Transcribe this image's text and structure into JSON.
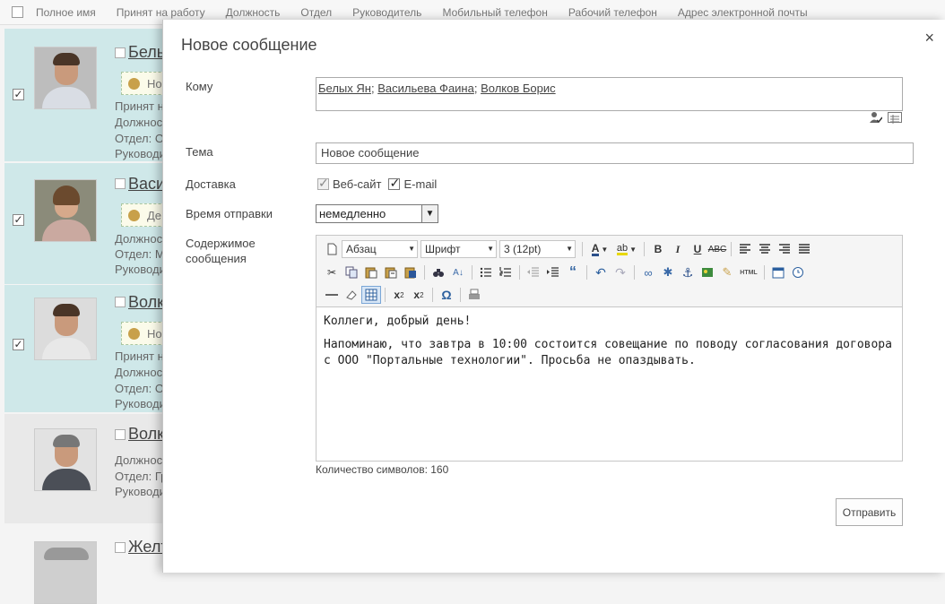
{
  "list": {
    "columns": [
      "Полное имя",
      "Принят на работу",
      "Должность",
      "Отдел",
      "Руководитель",
      "Мобильный телефон",
      "Рабочий телефон",
      "Адрес электронной почты"
    ],
    "rows": [
      {
        "name": "Бель",
        "lines": [
          "Принят н",
          "Должнос",
          "Отдел: О",
          "Руководи"
        ],
        "status": "Но",
        "selected": true
      },
      {
        "name": "Васи",
        "lines": [
          "Должнос",
          "Отдел: М",
          "Руководи"
        ],
        "status": "Де",
        "selected": true
      },
      {
        "name": "Волк",
        "lines": [
          "Принят н",
          "Должнос",
          "Отдел: О",
          "Руководи"
        ],
        "status": "Но",
        "selected": true
      },
      {
        "name": "Волк",
        "lines": [
          "Должнос",
          "Отдел: Гр",
          "Руководи"
        ],
        "selected": false
      },
      {
        "name": "Желт",
        "selected": false
      }
    ]
  },
  "modal": {
    "title": "Новое сообщение",
    "close_label": "×",
    "to_label": "Кому",
    "recipients": [
      "Белых Ян",
      "Васильева Фаина",
      "Волков Борис"
    ],
    "recipient_sep": ";",
    "subject_label": "Тема",
    "subject_value": "Новое сообщение",
    "delivery_label": "Доставка",
    "delivery_web": "Веб-сайт",
    "delivery_email": "E-mail",
    "send_time_label": "Время отправки",
    "send_time_value": "немедленно",
    "content_label_1": "Содержимое",
    "content_label_2": "сообщения",
    "toolbar": {
      "paragraph": "Абзац",
      "font": "Шрифт",
      "size": "3 (12pt)"
    },
    "body_line_1": "Коллеги, добрый день!",
    "body_line_2": "Напоминаю, что завтра в 10:00 состоится совещание по поводу согласования договора с ООО \"Портальные технологии\". Просьба не опаздывать.",
    "char_count": "Количество символов: 160",
    "send_button": "Отправить"
  },
  "colors": {
    "selected_row": "#cfe8e9",
    "dept_text": "#2b6f6f"
  }
}
